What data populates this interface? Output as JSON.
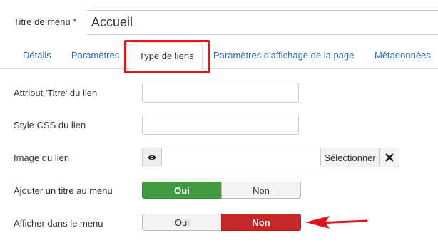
{
  "title_field": {
    "label": "Titre de menu *",
    "value": "Accueil"
  },
  "tabs": [
    {
      "label": "Détails",
      "active": false
    },
    {
      "label": "Paramètres",
      "active": false
    },
    {
      "label": "Type de liens",
      "active": true
    },
    {
      "label": "Paramètres d'affichage de la page",
      "active": false
    },
    {
      "label": "Métadonnées",
      "active": false
    }
  ],
  "fields": {
    "link_title_attr": {
      "label": "Attribut 'Titre' du lien",
      "value": ""
    },
    "link_css": {
      "label": "Style CSS du lien",
      "value": ""
    },
    "link_image": {
      "label": "Image du lien",
      "value": "",
      "select_label": "Sélectionner",
      "preview_icon": "eye-icon",
      "clear_icon": "x-icon"
    },
    "add_title": {
      "label": "Ajouter un titre au menu",
      "yes": "Oui",
      "no": "Non",
      "selected": "Oui"
    },
    "show_in_menu": {
      "label": "Afficher dans le menu",
      "yes": "Oui",
      "no": "Non",
      "selected": "Non"
    }
  },
  "colors": {
    "link": "#2a69b8",
    "active_yes": "#3f9a3f",
    "active_no": "#c52827",
    "highlight": "#e1141a"
  }
}
